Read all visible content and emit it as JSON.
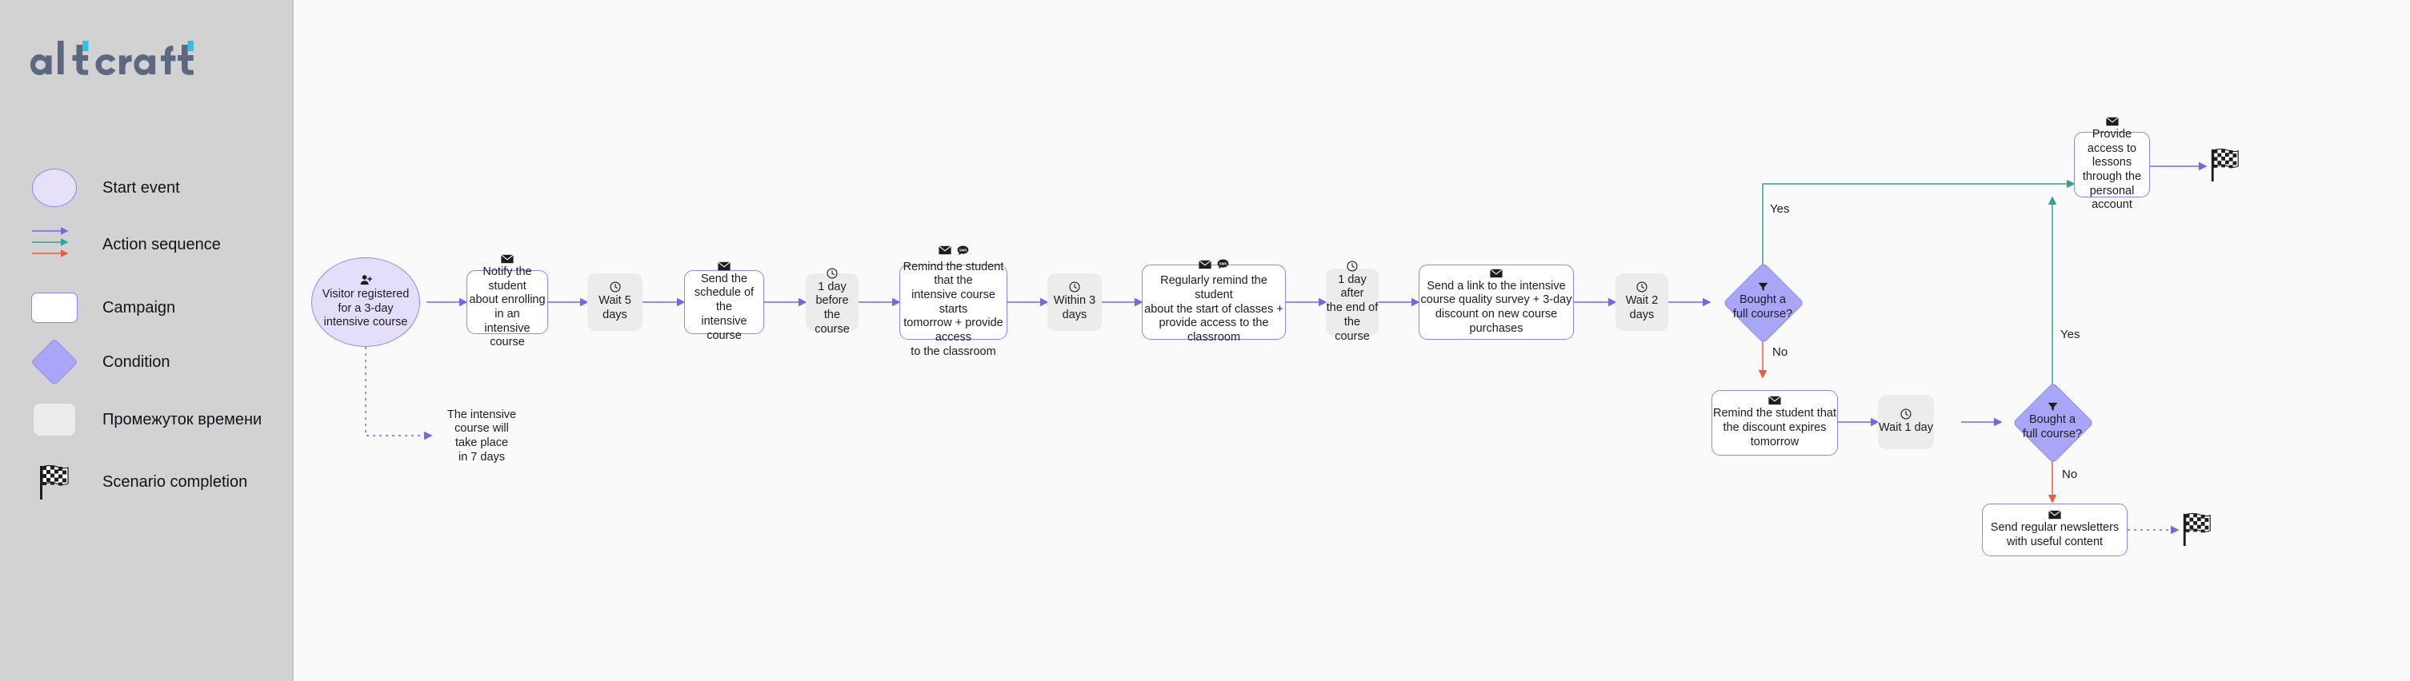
{
  "sidebar": {
    "logo_text": "altcraft",
    "legend": [
      {
        "id": "start-event",
        "shape": "circle",
        "label": "Start event"
      },
      {
        "id": "action-sequence",
        "shape": "arrows",
        "label": "Action sequence"
      },
      {
        "id": "campaign",
        "shape": "rect",
        "label": "Campaign"
      },
      {
        "id": "condition",
        "shape": "diamond",
        "label": "Condition"
      },
      {
        "id": "time-interval",
        "shape": "rect-gray",
        "label": "Промежуток времени"
      },
      {
        "id": "scenario-completion",
        "shape": "flag",
        "label": "Scenario completion"
      }
    ]
  },
  "colors": {
    "sidebar_bg": "#d2d2d2",
    "canvas_bg": "#fafafa",
    "accent_purple": "#8b8ae8",
    "condition_fill": "#aaa6f7",
    "start_fill": "#e5defb",
    "wait_fill": "#ececec",
    "edge_blue": "#6c6ce0",
    "edge_teal": "#2fa395",
    "edge_red": "#ef5b3c",
    "logo_dark": "#5b6880",
    "logo_cyan": "#27c2f0"
  },
  "flow": {
    "nodes": [
      {
        "id": "start",
        "type": "start",
        "icon": "user-plus-icon",
        "label": "Visitor registered\nfor a 3-day\nintensive course"
      },
      {
        "id": "note",
        "type": "note",
        "icon": null,
        "label": "The intensive\ncourse will\ntake place\nin 7 days"
      },
      {
        "id": "camp1",
        "type": "campaign",
        "icon": "email-icon",
        "label": "Notify the student\nabout enrolling in an\nintensive course"
      },
      {
        "id": "wait1",
        "type": "wait",
        "icon": "clock-icon",
        "label": "Wait 5 days"
      },
      {
        "id": "camp2",
        "type": "campaign",
        "icon": "email-icon",
        "label": "Send the\nschedule of the\nintensive course"
      },
      {
        "id": "wait2",
        "type": "wait",
        "icon": "clock-icon",
        "label": "1 day before\nthe course"
      },
      {
        "id": "camp3",
        "type": "campaign",
        "icon": "email-icon,sms-icon",
        "label": "Remind the student that the\nintensive course starts\ntomorrow + provide access\nto the classroom"
      },
      {
        "id": "wait3",
        "type": "wait",
        "icon": "clock-icon",
        "label": "Within 3 days"
      },
      {
        "id": "camp4",
        "type": "campaign",
        "icon": "email-icon,sms-icon",
        "label": "Regularly remind the student\nabout the start of classes +\nprovide access to the\nclassroom"
      },
      {
        "id": "wait4",
        "type": "wait",
        "icon": "clock-icon",
        "label": "1 day after\nthe end of\nthe course"
      },
      {
        "id": "camp5",
        "type": "campaign",
        "icon": "email-icon",
        "label": "Send a link to the intensive\ncourse quality survey + 3-day\ndiscount on new course\npurchases"
      },
      {
        "id": "wait5",
        "type": "wait",
        "icon": "clock-icon",
        "label": "Wait 2 days"
      },
      {
        "id": "cond1",
        "type": "condition",
        "icon": "funnel-icon",
        "label": "Bought a\nfull course?"
      },
      {
        "id": "camp6",
        "type": "campaign",
        "icon": "email-icon",
        "label": "Provide access to\nlessons through the\npersonal account"
      },
      {
        "id": "flag1",
        "type": "flag",
        "icon": "checkered-flag-icon",
        "label": ""
      },
      {
        "id": "camp7",
        "type": "campaign",
        "icon": "email-icon",
        "label": "Remind the student that\nthe discount expires\ntomorrow"
      },
      {
        "id": "wait6",
        "type": "wait",
        "icon": "clock-icon",
        "label": "Wait 1 day"
      },
      {
        "id": "cond2",
        "type": "condition",
        "icon": "funnel-icon",
        "label": "Bought a\nfull course?"
      },
      {
        "id": "camp8",
        "type": "campaign",
        "icon": "email-icon",
        "label": "Send regular newsletters\nwith useful content"
      },
      {
        "id": "flag2",
        "type": "flag",
        "icon": "checkered-flag-icon",
        "label": ""
      }
    ],
    "edge_labels": [
      {
        "id": "cond1-yes",
        "text": "Yes"
      },
      {
        "id": "cond1-no",
        "text": "No"
      },
      {
        "id": "cond2-yes",
        "text": "Yes"
      },
      {
        "id": "cond2-no",
        "text": "No"
      }
    ]
  }
}
